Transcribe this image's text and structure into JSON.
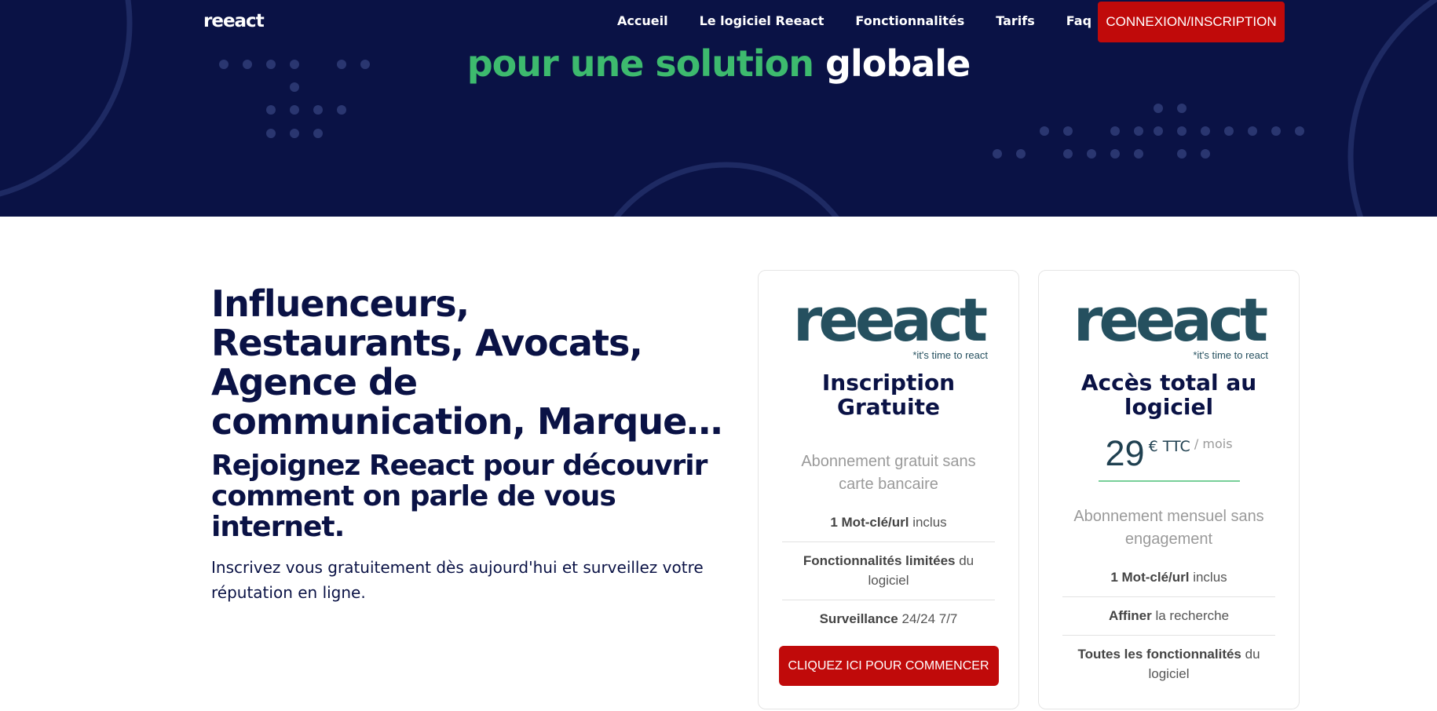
{
  "nav": {
    "logo": "reeact",
    "links": [
      "Accueil",
      "Le logiciel Reeact",
      "Fonctionnalités",
      "Tarifs",
      "Faq"
    ],
    "cta": "CONNEXION/INSCRIPTION"
  },
  "hero": {
    "title_green": "pour une solution",
    "title_white": "globale"
  },
  "intro": {
    "heading": "Influenceurs, Restaurants, Avocats, Agence de communication, Marque…",
    "subheading": "Rejoignez Reeact pour découvrir comment on parle de vous internet.",
    "text": "Inscrivez vous gratuitement dès aujourd'hui et surveillez votre réputation en ligne."
  },
  "brand": {
    "word": "reeact",
    "tagline": "*it's time to react"
  },
  "plans": [
    {
      "title": "Inscription Gratuite",
      "subtitle": "Abonnement gratuit sans carte bancaire",
      "features": [
        {
          "bold": "1 Mot-clé/url",
          "rest": " inclus"
        },
        {
          "bold": "Fonctionnalités limitées",
          "rest": " du logiciel"
        },
        {
          "bold": "Surveillance",
          "rest": " 24/24 7/7"
        }
      ],
      "button": "CLIQUEZ ICI POUR COMMENCER"
    },
    {
      "title": "Accès total au logiciel",
      "price": "29",
      "currency": "€ TTC",
      "period": "/ mois",
      "subtitle": "Abonnement mensuel sans engagement",
      "features": [
        {
          "bold": "1 Mot-clé/url",
          "rest": " inclus"
        },
        {
          "bold": "Affiner",
          "rest": " la recherche"
        },
        {
          "bold": "Toutes les fonctionnalités",
          "rest": " du logiciel"
        }
      ]
    }
  ],
  "colors": {
    "navy": "#0a1245",
    "green": "#3dba6e",
    "red": "#c00a0a",
    "brand_teal": "#25505f"
  }
}
